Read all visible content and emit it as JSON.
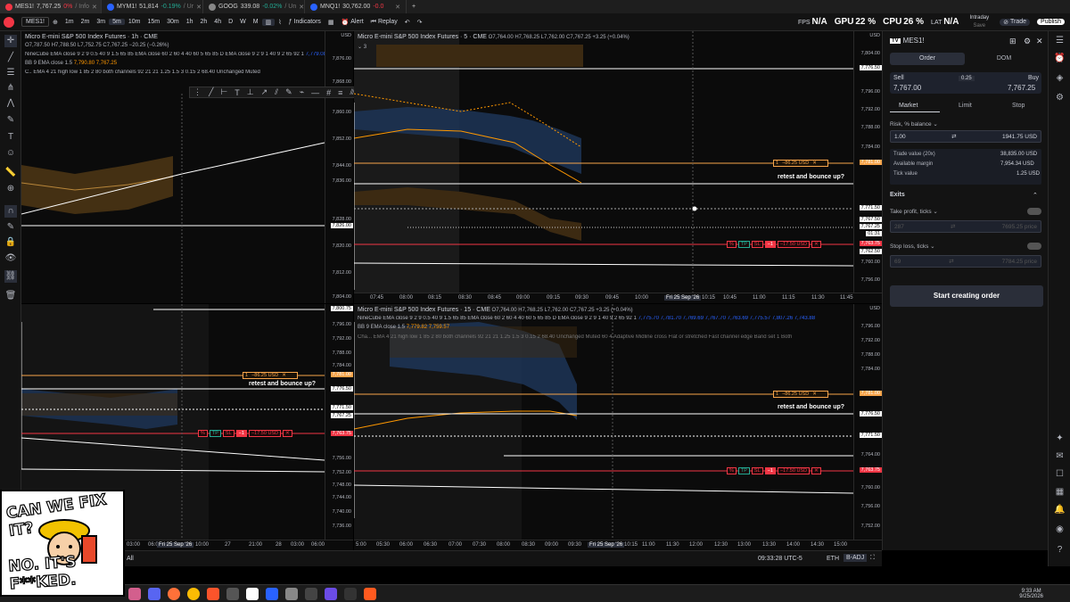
{
  "browser_tabs": [
    {
      "symbol": "MES1!",
      "price": "7,767.25",
      "change": "0%",
      "suffix": "/ Info"
    },
    {
      "symbol": "MYM1!",
      "price": "51,814",
      "change": "-0.19%",
      "suffix": "/ Ur"
    },
    {
      "symbol": "GOOG",
      "price": "339.08",
      "change": "-0.02%",
      "suffix": "/ Un"
    },
    {
      "symbol": "MNQ1!",
      "price": "30,762.00",
      "change": "-0.0",
      "suffix": ""
    }
  ],
  "toolbar": {
    "symbol": "MES1!",
    "intervals": [
      "1m",
      "2m",
      "3m",
      "5m",
      "10m",
      "15m",
      "30m",
      "1h",
      "2h",
      "4h",
      "D",
      "W",
      "M"
    ],
    "active_interval": "5m",
    "indicators_label": "Indicators",
    "alert_label": "Alert",
    "replay_label": "Replay",
    "fps_label": "FPS",
    "fps_value": "N/A",
    "gpu_label": "GPU",
    "gpu_value": "22 %",
    "cpu_label": "CPU",
    "cpu_value": "26 %",
    "lat_label": "LAT",
    "lat_value": "N/A",
    "layout_name": "Intraday",
    "layout_sub": "Save",
    "trade_label": "Trade",
    "publish_label": "Publish"
  },
  "pane_1h": {
    "title": "Micro E-mini S&P 500 Index Futures · 1h · CME",
    "ohlc": "O7,787.50 H7,788.50 L7,752.75 C7,767.25 −20.25 (−0.26%)",
    "ind1": "NineCube EMA close 9 2 9 0.5 40 9 1.5 65 85 EMA close 60 2 60 4 40 60 5 65 85 D EMA close 9 2 9 1 40 9 2 65 92 1",
    "ind1_value": "7,779.08",
    "ind2": "BB 9 EMA close 1.5",
    "ind2_values": "7,790.80 7,767.25",
    "ind3": "C.. EMA 4 21 high low 1 85 2 80 both channels 92 21 21 1.25 1.5 3 0.15 2 68.40 Unchanged Muted",
    "currency": "USD",
    "prices": [
      "7,876.00",
      "7,868.00",
      "7,860.00",
      "7,852.00",
      "7,844.00",
      "7,836.00",
      "7,828.00",
      "7,820.00",
      "7,812.00",
      "7,804.00"
    ],
    "price_hl": "7,826.00"
  },
  "pane_5m": {
    "title": "Micro E-mini S&P 500 Index Futures · 5 · CME",
    "ohlc": "O7,764.00 H7,768.25 L7,762.00 C7,767.25 +3.25 (+0.04%)",
    "hidden_count": "3",
    "currency": "USD",
    "prices": [
      "7,804.00",
      "7,800.00",
      "7,796.00",
      "7,792.00",
      "7,788.00",
      "7,784.00",
      "7,780.00",
      "7,776.00",
      "7,772.00",
      "7,768.00",
      "7,764.00",
      "7,760.00",
      "7,756.00"
    ],
    "tags": {
      "order": "7,781.00",
      "white": "7,776.50",
      "cross": "7,771.50",
      "hl1": "7,767.50",
      "hl2": "7,767.25",
      "timer": "01:31",
      "position": "7,763.75",
      "p2": "7,762.50",
      "p3": "7,761.60"
    },
    "times": [
      "07:45",
      "08:00",
      "08:15",
      "08:30",
      "08:45",
      "09:00",
      "09:15",
      "09:30",
      "09:45",
      "10:00",
      "10:15",
      "10:30",
      "10:45",
      "11:00",
      "11:15",
      "11:30",
      "11:45"
    ],
    "time_hl": "Fri 25 Sep '26"
  },
  "pane_15m": {
    "title": "Micro E-mini S&P 500 Index Futures · 15 · CME",
    "ohlc": "O7,764.00 H7,768.25 L7,762.00 C7,767.25 +3.25 (+0.04%)",
    "ind1": "NineCube EMA close 9 2 9 0.5 40 9 1.5 65 85 EMA close 60 2 60 4 40 60 5 65 85 D EMA close 9 2 9 1 40 9 2 65 92 1",
    "ind1_values": "7,775.70 7,781.70 7,769.69 7,767.70 7,763.69 7,775.57 7,807.26 7,743.88",
    "ind2": "BB 9 EMA close 1.5",
    "ind2_values": "7,779.82 7,759.57",
    "ind3": "Cha... EMA 4 21 high low 1 85 2 80 both channels 92 21 21 1.25 1.5 3 0.15 2 68.40 Unchanged Muted 60 4 Adaptive Midline cross Flat or stretched Fast channel edge Band set 1 Both",
    "currency": "USD",
    "prices": [
      "7,800.00",
      "7,796.00",
      "7,792.00",
      "7,788.00",
      "7,784.00",
      "7,780.00",
      "7,776.00",
      "7,772.00",
      "7,768.00",
      "7,764.00",
      "7,760.00",
      "7,756.00",
      "7,752.00",
      "7,748.00",
      "7,744.00",
      "7,740.00",
      "7,736.00"
    ],
    "times": [
      "5:00",
      "05:30",
      "06:00",
      "06:30",
      "07:00",
      "07:30",
      "08:00",
      "08:30",
      "09:00",
      "09:30",
      "10:00",
      "10:15",
      "11:00",
      "11:30",
      "12:00",
      "12:30",
      "13:00",
      "13:30",
      "14:00",
      "14:30",
      "15:00"
    ],
    "time_hl": "Fri 25 Sep '26"
  },
  "pane_left_bottom": {
    "prices": [
      "7,800.75",
      "7,796.00",
      "7,792.00",
      "7,788.00",
      "7,784.00",
      "7,780.00",
      "7,776.00",
      "7,772.00",
      "7,768.00",
      "7,764.00",
      "7,760.00",
      "7,756.00",
      "7,752.00",
      "7,748.00",
      "7,744.00",
      "7,740.00",
      "7,736.00"
    ],
    "times": [
      "03:00",
      "06:0",
      "10:00",
      "27",
      "21:00",
      "28",
      "03:00",
      "06:00"
    ],
    "time_hl": "Fri 25 Sep '26"
  },
  "annotations": {
    "retest": "retest and bounce up?",
    "order_qty": "1",
    "order_pnl": "−86.25 USD",
    "pos_pct": "%",
    "pos_tp": "TP",
    "pos_sl": "SL",
    "pos_qty": "−1",
    "pos_pnl": "−17.50 USD"
  },
  "order_panel": {
    "symbol": "MES1!",
    "tabs": [
      "Order",
      "DOM"
    ],
    "sell_label": "Sell",
    "sell_price": "7,767.00",
    "spread": "0.25",
    "buy_label": "Buy",
    "buy_price": "7,767.25",
    "order_types": [
      "Market",
      "Limit",
      "Stop"
    ],
    "risk_label": "Risk, % balance",
    "risk_value": "1.00",
    "risk_usd": "1941.75 USD",
    "trade_value_label": "Trade value (20x)",
    "trade_value": "38,835.00 USD",
    "margin_label": "Available margin",
    "margin_value": "7,954.34 USD",
    "tick_label": "Tick value",
    "tick_value": "1.25 USD",
    "exits_label": "Exits",
    "tp_label": "Take profit, ticks",
    "tp_value": "287",
    "tp_price": "7695.25 price",
    "sl_label": "Stop loss, ticks",
    "sl_value": "69",
    "sl_price": "7784.25 price",
    "submit_label": "Start creating order"
  },
  "bottom_bar": {
    "all_label": "All",
    "clock": "09:33:28 UTC-5",
    "session": "ETH",
    "adj": "B-ADJ"
  },
  "taskbar": {
    "time": "9:33 AM",
    "date": "9/25/2026"
  },
  "meme": {
    "line1": "CAN WE FIX IT?",
    "line2": "NO. IT'S F**KED."
  }
}
